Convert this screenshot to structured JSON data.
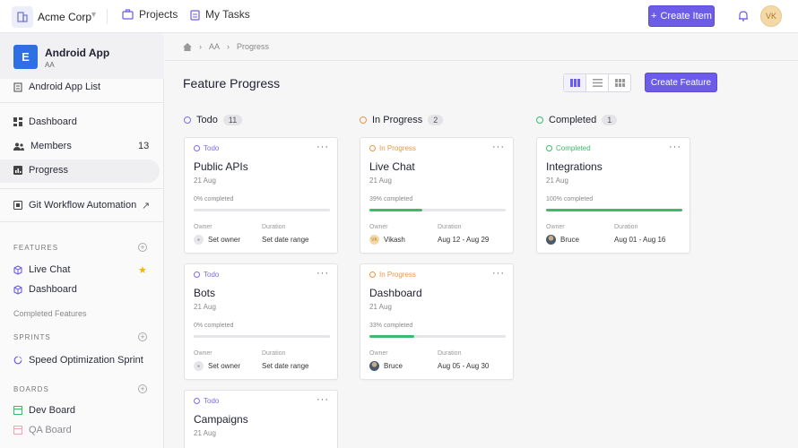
{
  "topbar": {
    "workspace_name": "Acme Corp",
    "nav_projects": "Projects",
    "nav_tasks": "My Tasks",
    "create_item_label": "Create Item",
    "user_initials": "VK"
  },
  "sidebar": {
    "app_initial": "E",
    "app_name": "Android App",
    "app_key": "AA",
    "list_label": "Android App List",
    "nav": [
      {
        "label": "Dashboard"
      },
      {
        "label": "Members",
        "count": "13"
      },
      {
        "label": "Progress"
      }
    ],
    "git_label": "Git Workflow Automation",
    "external_icon": "↗",
    "features_section": "FEATURES",
    "features": [
      {
        "label": "Live Chat"
      },
      {
        "label": "Dashboard"
      }
    ],
    "completed_features": "Completed Features",
    "sprints_section": "SPRINTS",
    "sprints": [
      {
        "label": "Speed Optimization Sprint"
      }
    ],
    "boards_section": "BOARDS",
    "boards": [
      {
        "label": "Dev Board"
      },
      {
        "label": "QA Board"
      }
    ]
  },
  "breadcrumb": {
    "items": [
      "AA",
      "Progress"
    ]
  },
  "main": {
    "title": "Feature Progress",
    "create_feature_label": "Create Feature"
  },
  "labels": {
    "owner": "Owner",
    "duration": "Duration"
  },
  "colors": {
    "accent": "#6c5ce7",
    "todo": "#7b6ee8",
    "in_progress": "#e8964a",
    "completed": "#3dbb6c"
  },
  "columns": [
    {
      "name": "Todo",
      "count": "11",
      "status_key": "todo",
      "cards": [
        {
          "status": "Todo",
          "title": "Public APIs",
          "date": "21 Aug",
          "progress_text": "0% completed",
          "progress": 0,
          "owner": "Set owner",
          "owner_avatar": "empty",
          "duration": "Set date range"
        },
        {
          "status": "Todo",
          "title": "Bots",
          "date": "21 Aug",
          "progress_text": "0% completed",
          "progress": 0,
          "owner": "Set owner",
          "owner_avatar": "empty",
          "duration": "Set date range"
        },
        {
          "status": "Todo",
          "title": "Campaigns",
          "date": "21 Aug"
        }
      ]
    },
    {
      "name": "In Progress",
      "count": "2",
      "status_key": "in_progress",
      "cards": [
        {
          "status": "In Progress",
          "title": "Live Chat",
          "date": "21 Aug",
          "progress_text": "39% completed",
          "progress": 39,
          "owner": "Vikash",
          "owner_avatar": "VK",
          "duration": "Aug 12 - Aug 29"
        },
        {
          "status": "In Progress",
          "title": "Dashboard",
          "date": "21 Aug",
          "progress_text": "33% completed",
          "progress": 33,
          "owner": "Bruce",
          "owner_avatar": "photo",
          "duration": "Aug 05 - Aug 30"
        }
      ]
    },
    {
      "name": "Completed",
      "count": "1",
      "status_key": "completed",
      "cards": [
        {
          "status": "Completed",
          "title": "Integrations",
          "date": "21 Aug",
          "progress_text": "100% completed",
          "progress": 100,
          "owner": "Bruce",
          "owner_avatar": "photo",
          "duration": "Aug 01 - Aug 16"
        }
      ]
    }
  ]
}
